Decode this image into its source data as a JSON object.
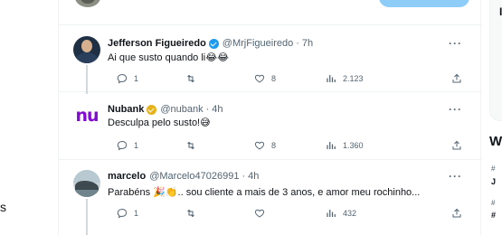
{
  "left_fragment": "s",
  "tweets": [
    {
      "name": "Jefferson Figueiredo",
      "handle": "@MrjFigueiredo",
      "time": "7h",
      "text": "Ai que susto quando li😂😂",
      "reply_count": "1",
      "retweet_count": "",
      "like_count": "8",
      "view_count": "2.123",
      "verified": "blue"
    },
    {
      "name": "Nubank",
      "handle": "@nubank",
      "time": "4h",
      "text": "Desculpa pelo susto!😅",
      "reply_count": "1",
      "retweet_count": "",
      "like_count": "8",
      "view_count": "1.360",
      "verified": "gold",
      "avatar_text": "nu"
    },
    {
      "name": "marcelo",
      "handle": "@Marcelo47026991",
      "time": "4h",
      "text": "Parabéns 🎉👏.. sou cliente a mais de 3 anos, e amor meu rochinho...",
      "reply_count": "1",
      "retweet_count": "",
      "like_count": "",
      "view_count": "432"
    }
  ],
  "separator": "·",
  "more_label": "···",
  "right_fragments": [
    "I",
    "W",
    "#",
    "J",
    "#",
    "#"
  ],
  "colors": {
    "accent": "#1d9bf0",
    "secondary_text": "#536471",
    "border": "#eff3f4",
    "nubank_purple": "#820ad1",
    "gold_badge": "#e8b21c"
  }
}
